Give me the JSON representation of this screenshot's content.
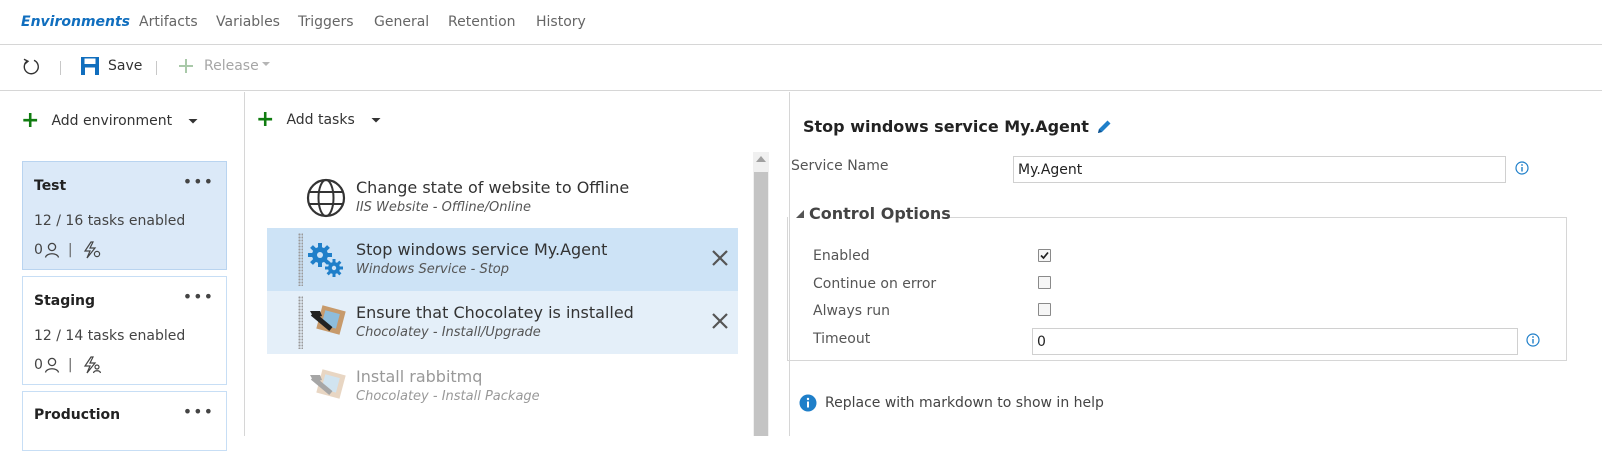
{
  "tabs": [
    {
      "label": "Environments",
      "active": true
    },
    {
      "label": "Artifacts"
    },
    {
      "label": "Variables"
    },
    {
      "label": "Triggers"
    },
    {
      "label": "General"
    },
    {
      "label": "Retention"
    },
    {
      "label": "History"
    }
  ],
  "toolbar": {
    "save_label": "Save",
    "release_label": "Release"
  },
  "environments": {
    "add_label": "Add environment",
    "items": [
      {
        "name": "Test",
        "tasks": "12 / 16 tasks enabled",
        "approvers": "0",
        "more": "•••",
        "sep": "|"
      },
      {
        "name": "Staging",
        "tasks": "12 / 14 tasks enabled",
        "approvers": "0",
        "more": "•••",
        "sep": "|"
      },
      {
        "name": "Production",
        "more": "•••"
      }
    ]
  },
  "tasks": {
    "add_label": "Add tasks",
    "items": [
      {
        "title": "Change state of website to Offline",
        "subtitle": "IIS Website - Offline/Online",
        "icon": "globe-icon"
      },
      {
        "title": "Stop windows service My.Agent",
        "subtitle": "Windows Service - Stop",
        "icon": "gears-icon",
        "state": "selected"
      },
      {
        "title": "Ensure that Chocolatey is installed",
        "subtitle": "Chocolatey - Install/Upgrade",
        "icon": "chocolatey-icon",
        "state": "hover"
      },
      {
        "title": "Install rabbitmq",
        "subtitle": "Chocolatey - Install Package",
        "icon": "chocolatey-icon",
        "state": "disabled"
      }
    ]
  },
  "details": {
    "title": "Stop windows service My.Agent",
    "service_name_label": "Service Name",
    "service_name_value": "My.Agent",
    "control_options_label": "Control Options",
    "enabled_label": "Enabled",
    "enabled": true,
    "continue_on_error_label": "Continue on error",
    "continue_on_error": false,
    "always_run_label": "Always run",
    "always_run": false,
    "timeout_label": "Timeout",
    "timeout_value": "0",
    "help_text": "Replace with markdown to show in help"
  },
  "colors": {
    "accent": "#106ebe",
    "add_green": "#107c10",
    "selected_row": "#cde3f6",
    "selected_card": "#dbe9f8"
  }
}
